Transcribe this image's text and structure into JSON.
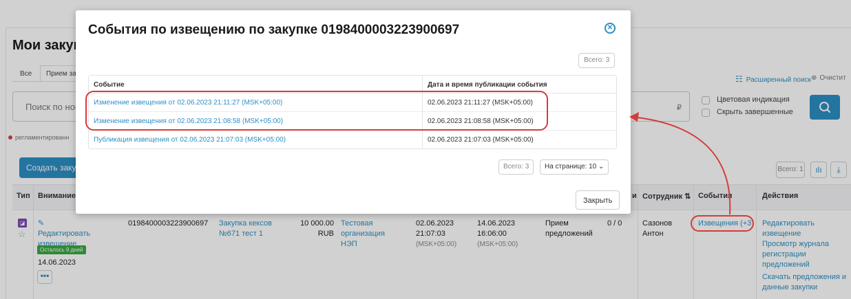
{
  "page": {
    "title": "Мои закуп",
    "tabs": [
      "Все",
      "Прием за"
    ],
    "search_placeholder": "Поиск по ном",
    "reg_note": "регламентированн",
    "create_button": "Создать закуп",
    "extended_search": "Расширенный поиск",
    "clear": "Очистит",
    "currency_symbol": "₽",
    "checkbox_color": "Цветовая индикация",
    "checkbox_hide": "Скрыть завершенные",
    "total": "Всего: 1"
  },
  "table": {
    "headers": {
      "type": "Тип",
      "attention": "Внимание",
      "n": "и",
      "employee": "Сотрудник ⇅",
      "events": "События",
      "actions": "Действия"
    },
    "row": {
      "attention_link": "Редактировать извещение",
      "deadline": "Осталось 9 дней",
      "date": "14.06.2023",
      "more": "•••",
      "number": "0198400003223900697",
      "name": "Закупка кексов №671 тест 1",
      "price": "10 000.00",
      "currency": "RUB",
      "org": "Тестовая организация НЭП",
      "pub_date": "02.06.2023",
      "pub_time": "21:07:03",
      "pub_tz": "(MSK+05:00)",
      "end_date": "14.06.2023",
      "end_time": "16:06:00",
      "end_tz": "(MSK+05:00)",
      "stage_1": "Прием",
      "stage_2": "предложений",
      "ratio": "0 / 0",
      "employee_1": "Сазонов",
      "employee_2": "Антон",
      "events_link": "Извещения (+3)",
      "actions": [
        "Редактировать извещение",
        "Просмотр журнала регистрации предложений",
        "Скачать предложения и данные закупки"
      ]
    }
  },
  "modal": {
    "title": "События по извещению по закупке 0198400003223900697",
    "total_top": "Всего: 3",
    "col_event": "Событие",
    "col_datetime": "Дата и время публикации события",
    "rows": [
      {
        "event": "Изменение извещения от 02.06.2023 21:11:27 (MSK+05:00)",
        "datetime": "02.06.2023 21:11:27 (MSK+05:00)"
      },
      {
        "event": "Изменение извещения от 02.06.2023 21:08:58 (MSK+05:00)",
        "datetime": "02.06.2023 21:08:58 (MSK+05:00)"
      },
      {
        "event": "Публикация извещения от 02.06.2023 21:07:03 (MSK+05:00)",
        "datetime": "02.06.2023 21:07:03 (MSK+05:00)"
      }
    ],
    "total_bottom": "Всего: 3",
    "per_page": "На странице: 10 ⌄",
    "close_button": "Закрыть"
  },
  "colors": {
    "accent": "#2d8ec4",
    "highlight": "#d63a3a",
    "badge_green": "#3aa844",
    "type_purple": "#7b4bb5"
  },
  "icons": [
    "filter-icon",
    "clear-icon",
    "search-icon",
    "chart-icon",
    "download-icon",
    "edit-icon",
    "star-icon",
    "close-circle-icon",
    "chevron-down-icon",
    "type-icon"
  ]
}
